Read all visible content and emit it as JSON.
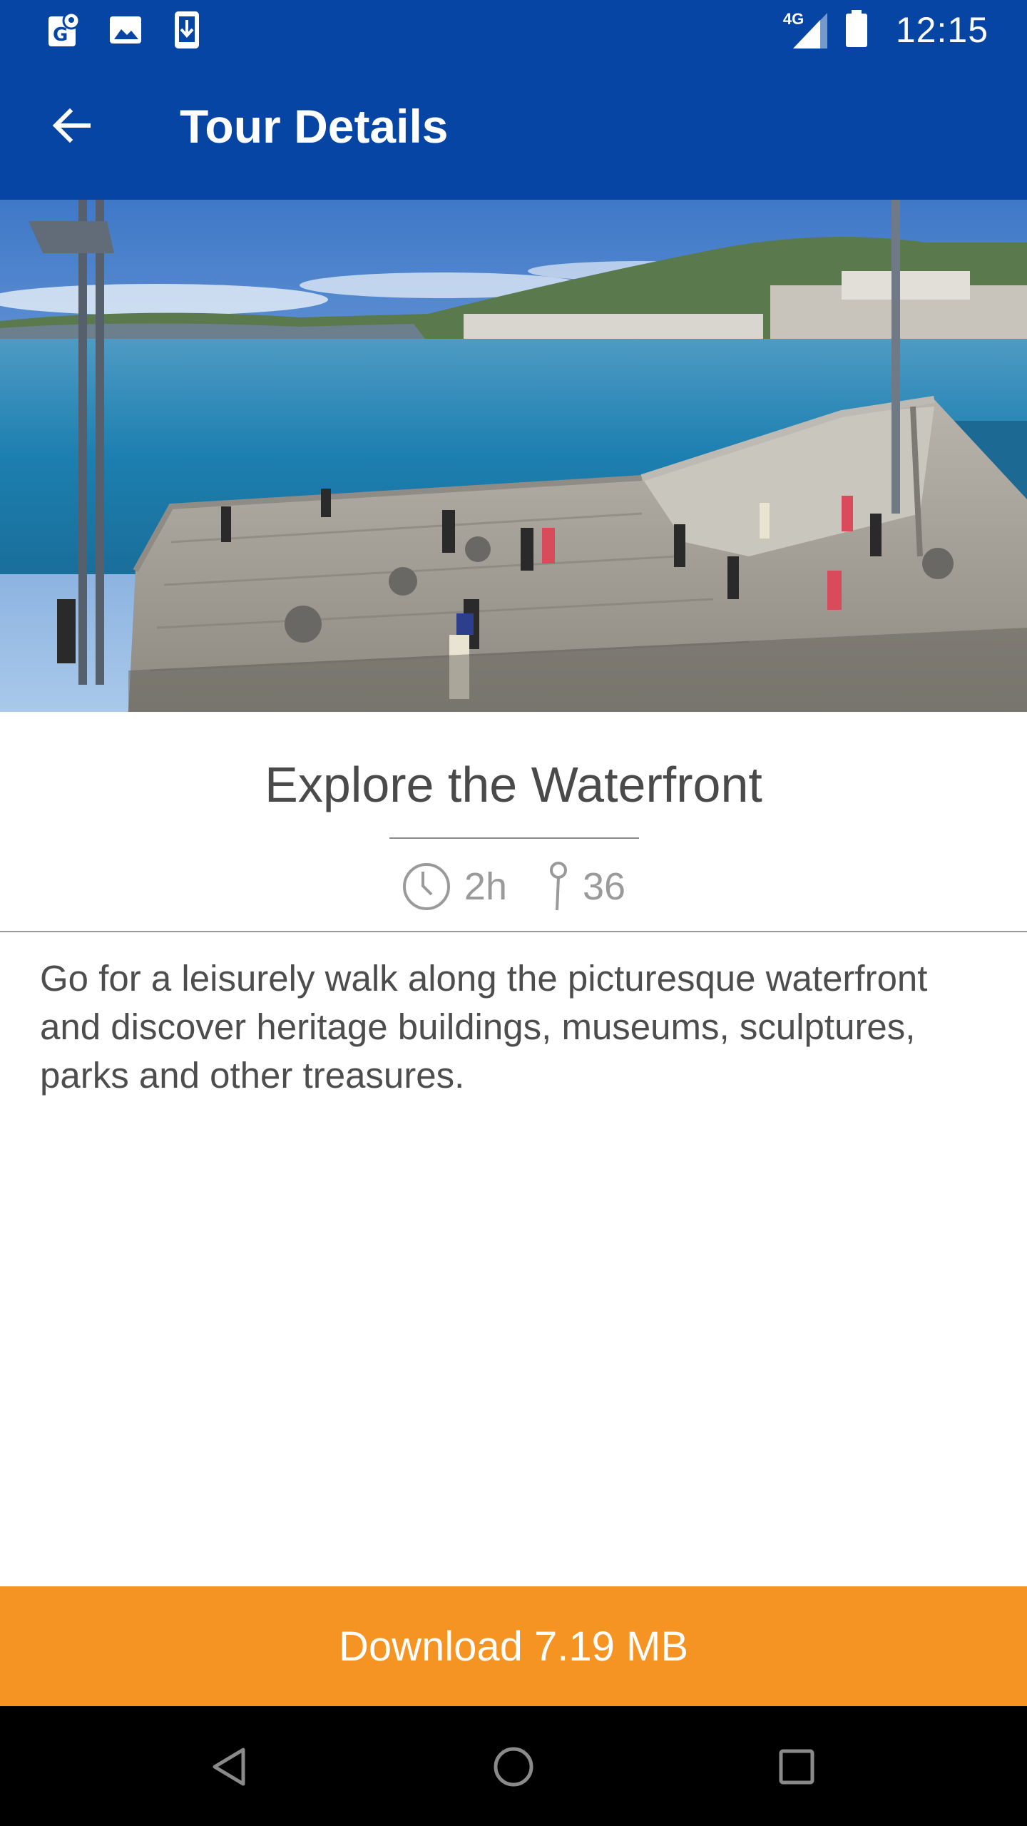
{
  "status_bar": {
    "time": "12:15",
    "network": "4G",
    "icons": [
      "maps-notification-icon",
      "image-notification-icon",
      "download-notification-icon",
      "signal-icon",
      "battery-icon"
    ]
  },
  "app_bar": {
    "title": "Tour Details",
    "back_icon": "arrow-back-icon"
  },
  "tour": {
    "title": "Explore the Waterfront",
    "duration": "2h",
    "stops": "36",
    "description": "Go for a leisurely walk along the picturesque waterfront and discover heritage buildings, museums, sculptures, parks and other treasures."
  },
  "download": {
    "label": "Download 7.19 MB"
  },
  "nav": {
    "icons": [
      "back-triangle-icon",
      "home-circle-icon",
      "recents-square-icon"
    ]
  },
  "colors": {
    "primary": "#0645a3",
    "accent": "#f59423",
    "text": "#4a4a4a",
    "meta": "#9a9a9a"
  }
}
